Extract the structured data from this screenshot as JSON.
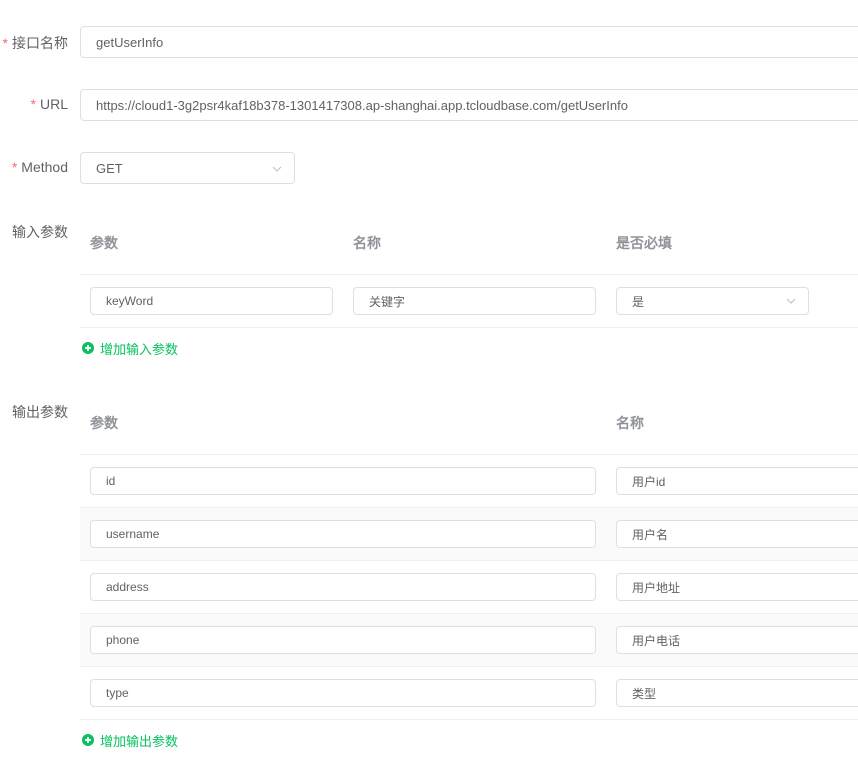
{
  "form": {
    "name_label": "接口名称",
    "name_value": "getUserInfo",
    "url_label": "URL",
    "url_value": "https://cloud1-3g2psr4kaf18b378-1301417308.ap-shanghai.app.tcloudbase.com/getUserInfo",
    "method_label": "Method",
    "method_value": "GET",
    "required_mark": "*"
  },
  "input_params": {
    "label": "输入参数",
    "headers": [
      "参数",
      "名称",
      "是否必填"
    ],
    "rows": [
      {
        "param": "keyWord",
        "name": "关键字",
        "required": "是"
      }
    ],
    "add_label": "增加输入参数"
  },
  "output_params": {
    "label": "输出参数",
    "headers": [
      "参数",
      "名称"
    ],
    "rows": [
      {
        "param": "id",
        "name": "用户id"
      },
      {
        "param": "username",
        "name": "用户名"
      },
      {
        "param": "address",
        "name": "用户地址"
      },
      {
        "param": "phone",
        "name": "用户电话"
      },
      {
        "param": "type",
        "name": "类型"
      }
    ],
    "add_label": "增加输出参数"
  },
  "colors": {
    "required": "#f56c6c",
    "accent": "#07c160",
    "border": "#dcdfe6"
  }
}
